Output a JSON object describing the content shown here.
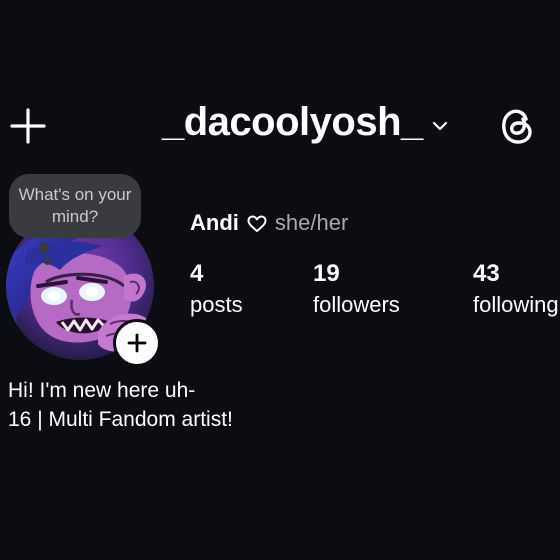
{
  "header": {
    "username": "_dacoolyosh_",
    "create_icon": "plus-icon",
    "account_switch_icon": "chevron-down-icon",
    "threads_icon": "threads-icon"
  },
  "note": {
    "placeholder": "What's on your mind?"
  },
  "profile": {
    "display_name": "Andi",
    "name_icon": "heart-outline-icon",
    "pronouns": "she/her",
    "avatar_icon": "avatar-illustration",
    "add_story_icon": "plus-icon"
  },
  "stats": [
    {
      "count": "4",
      "label": "posts"
    },
    {
      "count": "19",
      "label": "followers"
    },
    {
      "count": "43",
      "label": "following"
    }
  ],
  "bio": {
    "line1": "Hi! I'm new here uh-",
    "line2": "16 | Multi Fandom artist!"
  },
  "colors": {
    "background": "#0c0d12",
    "note_bubble": "#3a3b40",
    "secondary_text": "#a7a8ad",
    "text": "#ffffff"
  }
}
